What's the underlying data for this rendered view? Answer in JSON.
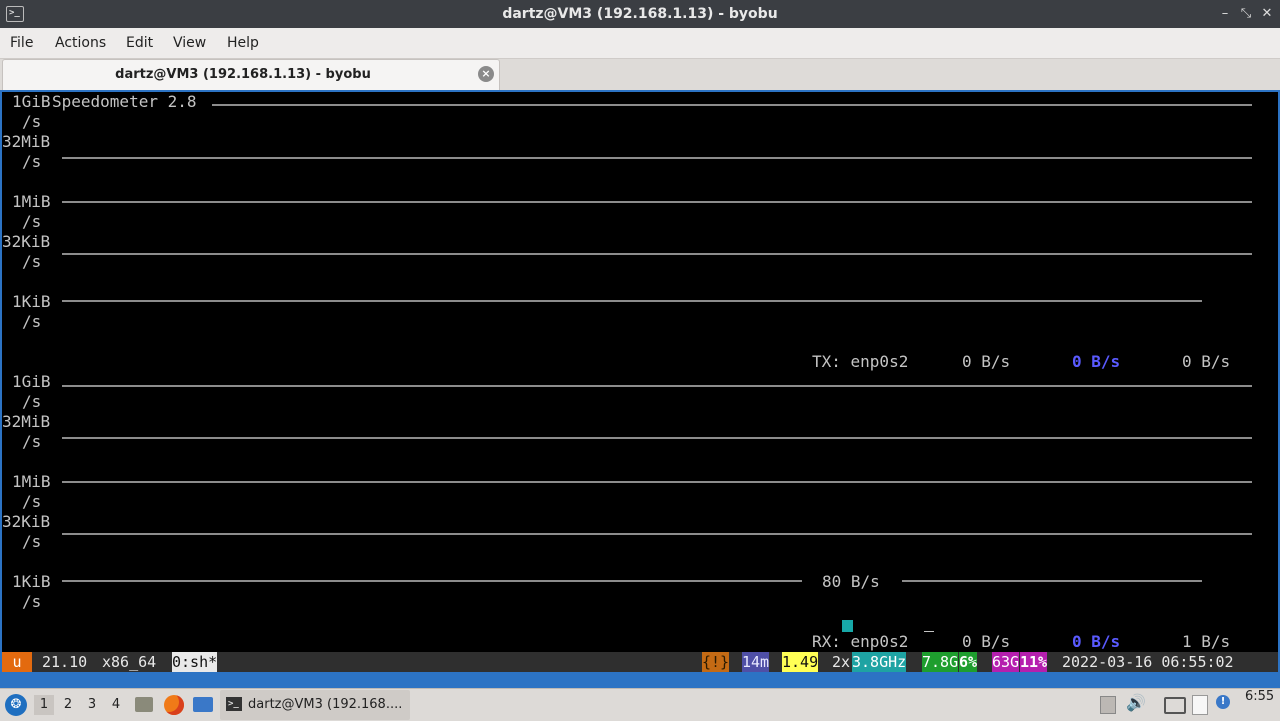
{
  "window": {
    "title": "dartz@VM3 (192.168.1.13) - byobu",
    "app_icon": ">_"
  },
  "menu": [
    "File",
    "Actions",
    "Edit",
    "View",
    "Help"
  ],
  "tab": {
    "label": "dartz@VM3 (192.168.1.13) - byobu"
  },
  "speedometer": {
    "title": "Speedometer 2.8",
    "tx_scale": [
      "1GiB",
      "/s",
      "32MiB",
      "/s",
      "1MiB",
      "/s",
      "32KiB",
      "/s",
      "1KiB",
      "/s"
    ],
    "rx_scale": [
      "1GiB",
      "/s",
      "32MiB",
      "/s",
      "1MiB",
      "/s",
      "32KiB",
      "/s",
      "1KiB",
      "/s"
    ],
    "tx": {
      "label": "TX: enp0s2",
      "current": "0 B/s",
      "average": "0 B/s",
      "peak": "0 B/s"
    },
    "rx": {
      "label": "RX: enp0s2",
      "current": "0 B/s",
      "average": "0 B/s",
      "peak": "1 B/s",
      "marker": "80 B/s"
    }
  },
  "statusbar": {
    "logo": "u",
    "release": "21.10",
    "arch": "x86_64",
    "window": "0:sh*",
    "alert": "{!}",
    "uptime": "14m",
    "load": "1.49",
    "cpu_count": "2x",
    "cpu_freq": "3.8GHz",
    "mem_total": "7.8G",
    "mem_pct": "6%",
    "disk_total": "63G",
    "disk_pct": "11%",
    "datetime": "2022-03-16 06:55:02"
  },
  "taskbar": {
    "workspaces": [
      "1",
      "2",
      "3",
      "4"
    ],
    "task_label": "dartz@VM3 (192.168....",
    "clock": "6:55"
  }
}
